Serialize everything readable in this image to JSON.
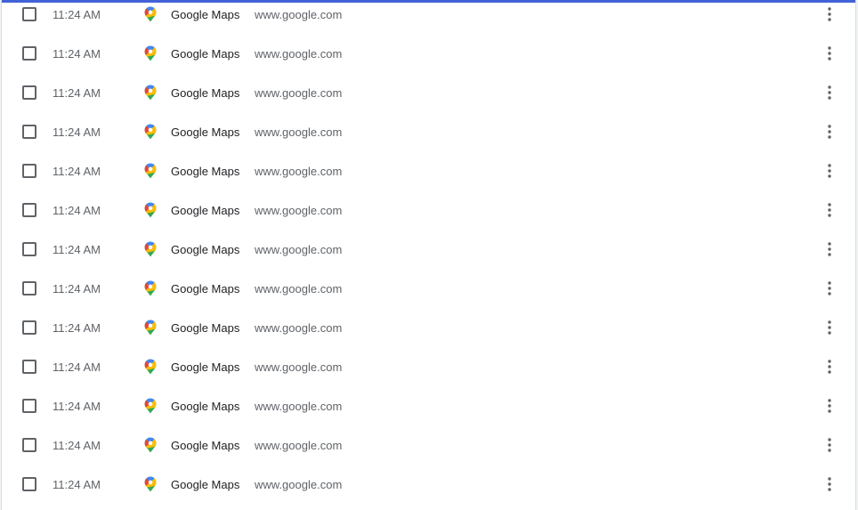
{
  "history": {
    "entries": [
      {
        "time": "11:24 AM",
        "title": "Google Maps",
        "domain": "www.google.com",
        "favicon": "google-maps-icon"
      },
      {
        "time": "11:24 AM",
        "title": "Google Maps",
        "domain": "www.google.com",
        "favicon": "google-maps-icon"
      },
      {
        "time": "11:24 AM",
        "title": "Google Maps",
        "domain": "www.google.com",
        "favicon": "google-maps-icon"
      },
      {
        "time": "11:24 AM",
        "title": "Google Maps",
        "domain": "www.google.com",
        "favicon": "google-maps-icon"
      },
      {
        "time": "11:24 AM",
        "title": "Google Maps",
        "domain": "www.google.com",
        "favicon": "google-maps-icon"
      },
      {
        "time": "11:24 AM",
        "title": "Google Maps",
        "domain": "www.google.com",
        "favicon": "google-maps-icon"
      },
      {
        "time": "11:24 AM",
        "title": "Google Maps",
        "domain": "www.google.com",
        "favicon": "google-maps-icon"
      },
      {
        "time": "11:24 AM",
        "title": "Google Maps",
        "domain": "www.google.com",
        "favicon": "google-maps-icon"
      },
      {
        "time": "11:24 AM",
        "title": "Google Maps",
        "domain": "www.google.com",
        "favicon": "google-maps-icon"
      },
      {
        "time": "11:24 AM",
        "title": "Google Maps",
        "domain": "www.google.com",
        "favicon": "google-maps-icon"
      },
      {
        "time": "11:24 AM",
        "title": "Google Maps",
        "domain": "www.google.com",
        "favicon": "google-maps-icon"
      },
      {
        "time": "11:24 AM",
        "title": "Google Maps",
        "domain": "www.google.com",
        "favicon": "google-maps-icon"
      },
      {
        "time": "11:24 AM",
        "title": "Google Maps",
        "domain": "www.google.com",
        "favicon": "google-maps-icon"
      }
    ]
  },
  "colors": {
    "accent": "#4262d6",
    "text_primary": "#202124",
    "text_secondary": "#5f6368",
    "maps_blue": "#4285f4",
    "maps_green": "#34a853",
    "maps_yellow": "#fbbc04",
    "maps_red": "#ea4335"
  }
}
